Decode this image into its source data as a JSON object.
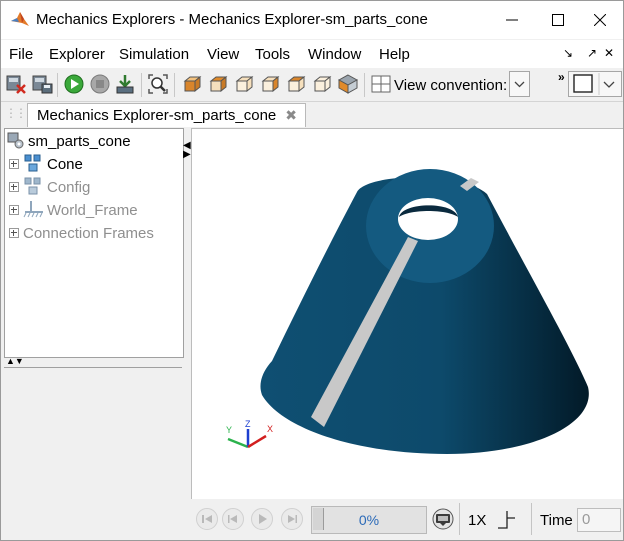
{
  "window": {
    "title": "Mechanics Explorers - Mechanics Explorer-sm_parts_cone"
  },
  "menu": [
    "File",
    "Explorer",
    "Simulation",
    "View",
    "Tools",
    "Window",
    "Help"
  ],
  "toolbar": {
    "view_convention_label": "View convention:",
    "icons": [
      "close-all-icon",
      "save-icon",
      "run-icon",
      "stop-icon",
      "import-icon",
      "zoom-fit-icon",
      "view-front-icon",
      "view-back-icon",
      "view-left-icon",
      "view-right-icon",
      "view-top-icon",
      "view-iso-icon",
      "layout-icon"
    ]
  },
  "tab": {
    "label": "Mechanics Explorer-sm_parts_cone",
    "close_glyph": "✖"
  },
  "tree": {
    "root": "sm_parts_cone",
    "children": [
      {
        "label": "Cone",
        "enabled": true
      },
      {
        "label": "Config",
        "enabled": false
      },
      {
        "label": "World_Frame",
        "enabled": false
      },
      {
        "label": "Connection Frames",
        "enabled": false
      }
    ]
  },
  "triad": {
    "x_label": "X",
    "y_label": "Y",
    "z_label": "Z"
  },
  "playback": {
    "progress_text": "0%",
    "progress_value": 0,
    "speed": "1X",
    "time_label": "Time",
    "time_value": "0"
  },
  "colors": {
    "cone": "#0b4a6c",
    "slot": "#c8c8c8",
    "accent": "#2b6ab8"
  }
}
